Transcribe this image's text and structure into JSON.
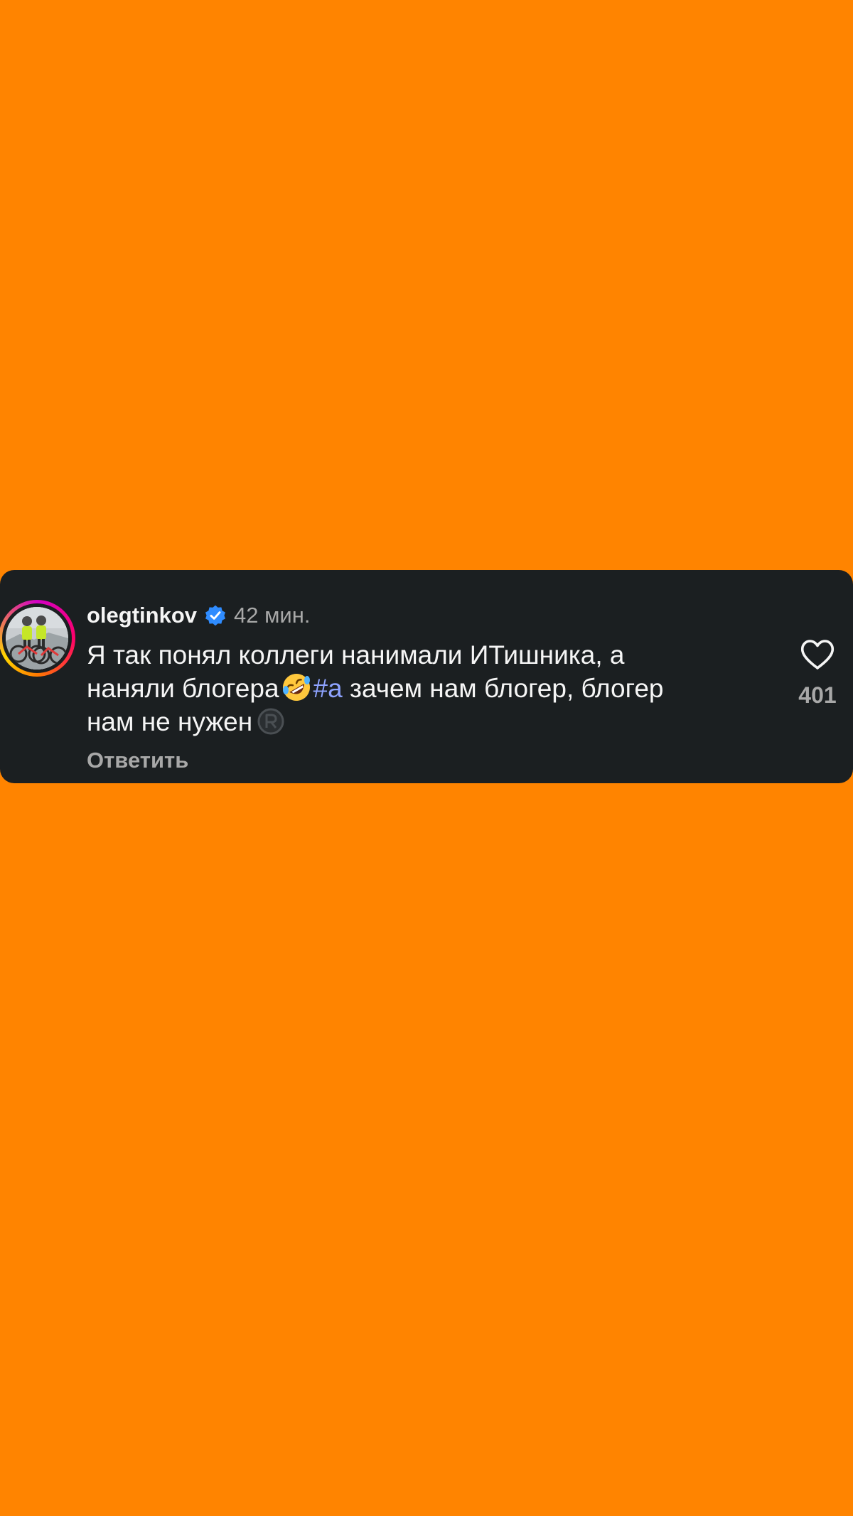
{
  "comment": {
    "username": "olegtinkov",
    "time": "42 мин.",
    "text_line1": "Я так понял коллеги нанимали ИТишника, а",
    "text_line2_before": "наняли блогера",
    "emoji_icon": "rolling-on-floor-laughing-emoji",
    "hashtag": "#а",
    "text_line2_after": " зачем нам блогер, блогер",
    "text_line3": "нам не нужен",
    "trailing_icon": "registered-sign-icon",
    "reply_label": "Ответить",
    "likes": "401"
  },
  "colors": {
    "background": "#FF8400",
    "card": "#1B1F21",
    "verified": "#2F8CFF",
    "hashtag": "#8EA3FF",
    "muted_text": "#A8A8A8"
  }
}
